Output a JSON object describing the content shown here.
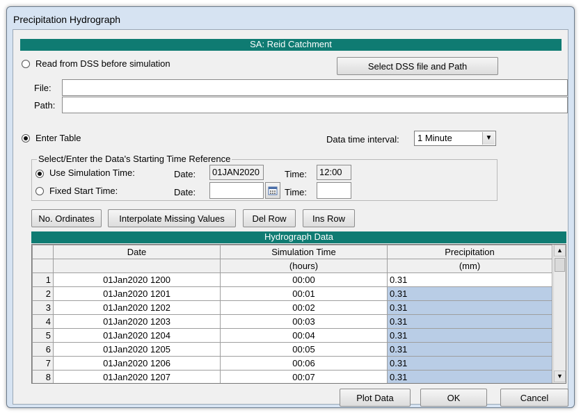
{
  "window": {
    "title": "Precipitation Hydrograph"
  },
  "header_banner": "SA: Reid Catchment",
  "dss": {
    "radio_label": "Read from DSS before simulation",
    "select_button": "Select DSS file and Path",
    "file_label": "File:",
    "file_value": "",
    "path_label": "Path:",
    "path_value": ""
  },
  "table_mode": {
    "radio_label": "Enter Table",
    "interval_label": "Data time interval:",
    "interval_value": "1 Minute"
  },
  "time_ref": {
    "group_label": "Select/Enter the Data's Starting Time Reference",
    "use_sim_label": "Use Simulation Time:",
    "fixed_label": "Fixed Start Time:",
    "date_label": "Date:",
    "time_label": "Time:",
    "sim_date": "01JAN2020",
    "sim_time": "12:00",
    "fixed_date": "",
    "fixed_time": ""
  },
  "toolbar": {
    "ordinates": "No. Ordinates",
    "interpolate": "Interpolate Missing Values",
    "del_row": "Del Row",
    "ins_row": "Ins Row"
  },
  "grid": {
    "title": "Hydrograph Data",
    "columns": [
      "Date",
      "Simulation Time",
      "Precipitation"
    ],
    "units": [
      "",
      "(hours)",
      "(mm)"
    ],
    "rows": [
      {
        "n": "1",
        "date": "01Jan2020 1200",
        "time": "00:00",
        "precip": "0.31"
      },
      {
        "n": "2",
        "date": "01Jan2020 1201",
        "time": "00:01",
        "precip": "0.31"
      },
      {
        "n": "3",
        "date": "01Jan2020 1202",
        "time": "00:02",
        "precip": "0.31"
      },
      {
        "n": "4",
        "date": "01Jan2020 1203",
        "time": "00:03",
        "precip": "0.31"
      },
      {
        "n": "5",
        "date": "01Jan2020 1204",
        "time": "00:04",
        "precip": "0.31"
      },
      {
        "n": "6",
        "date": "01Jan2020 1205",
        "time": "00:05",
        "precip": "0.31"
      },
      {
        "n": "7",
        "date": "01Jan2020 1206",
        "time": "00:06",
        "precip": "0.31"
      },
      {
        "n": "8",
        "date": "01Jan2020 1207",
        "time": "00:07",
        "precip": "0.31"
      }
    ]
  },
  "footer": {
    "plot": "Plot Data",
    "ok": "OK",
    "cancel": "Cancel"
  },
  "colors": {
    "banner": "#0f7b72",
    "selection": "#b9cde6"
  }
}
